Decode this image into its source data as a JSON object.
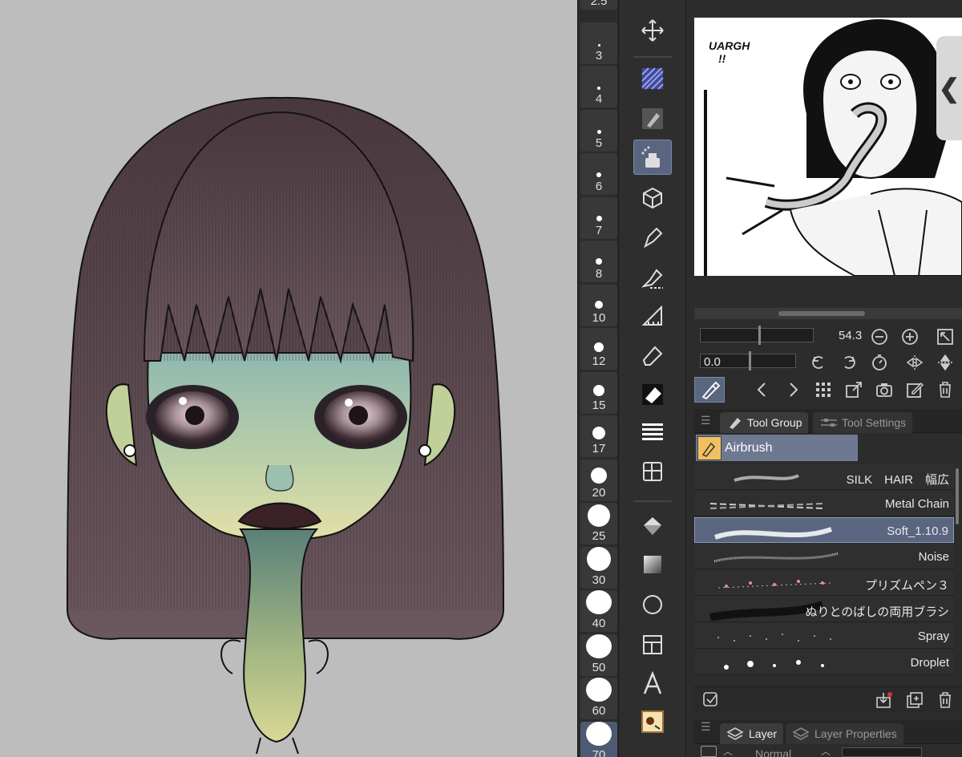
{
  "brush_sizes": [
    {
      "label": "2.5"
    },
    {
      "label": "3"
    },
    {
      "label": "4"
    },
    {
      "label": "5"
    },
    {
      "label": "6"
    },
    {
      "label": "7"
    },
    {
      "label": "8"
    },
    {
      "label": "10"
    },
    {
      "label": "12"
    },
    {
      "label": "15"
    },
    {
      "label": "17"
    },
    {
      "label": "20"
    },
    {
      "label": "25"
    },
    {
      "label": "30"
    },
    {
      "label": "40"
    },
    {
      "label": "50"
    },
    {
      "label": "60"
    },
    {
      "label": "70"
    }
  ],
  "selected_brush_size": "70",
  "tools": [
    {
      "name": "move-icon"
    },
    {
      "name": "selection-area-icon"
    },
    {
      "name": "pen-icon"
    },
    {
      "name": "airbrush-icon"
    },
    {
      "name": "3d-cube-icon"
    },
    {
      "name": "decoration-icon"
    },
    {
      "name": "correct-line-icon"
    },
    {
      "name": "ruler-icon"
    },
    {
      "name": "eraser-icon"
    },
    {
      "name": "fill-icon"
    },
    {
      "name": "gradient-icon"
    },
    {
      "name": "frame-border-icon"
    },
    {
      "name": "figure-icon"
    },
    {
      "name": "text-icon"
    },
    {
      "name": "balloon-icon"
    },
    {
      "name": "operation-icon"
    },
    {
      "name": "auto-select-icon"
    }
  ],
  "active_tool": "airbrush-icon",
  "navigator": {
    "comic_text": "UARGH\n!!",
    "zoom_value": "54.3",
    "rotate_value": "0.0"
  },
  "tool_group": {
    "tabs": {
      "group": "Tool Group",
      "settings": "Tool Settings"
    },
    "current": "Airbrush",
    "brushes": [
      {
        "label": "SILK　HAIR　幅広"
      },
      {
        "label": "Metal Chain"
      },
      {
        "label": "Soft_1.10.9"
      },
      {
        "label": "Noise"
      },
      {
        "label": "プリズムペン３"
      },
      {
        "label": "ぬりとのばしの両用ブラシ"
      },
      {
        "label": "Spray"
      },
      {
        "label": "Droplet"
      }
    ],
    "selected_brush": "Soft_1.10.9"
  },
  "layer_panel": {
    "tabs": {
      "layer": "Layer",
      "properties": "Layer Properties"
    },
    "blend_mode": "Normal"
  },
  "colors": {
    "panel_bg": "#2c2c2c",
    "selection_blue": "#5a6680",
    "canvas_bg": "#bdbdbd",
    "hair": "#5a4a50",
    "skin_top": "#8fb8b0",
    "skin_bottom": "#e4e0a8"
  }
}
